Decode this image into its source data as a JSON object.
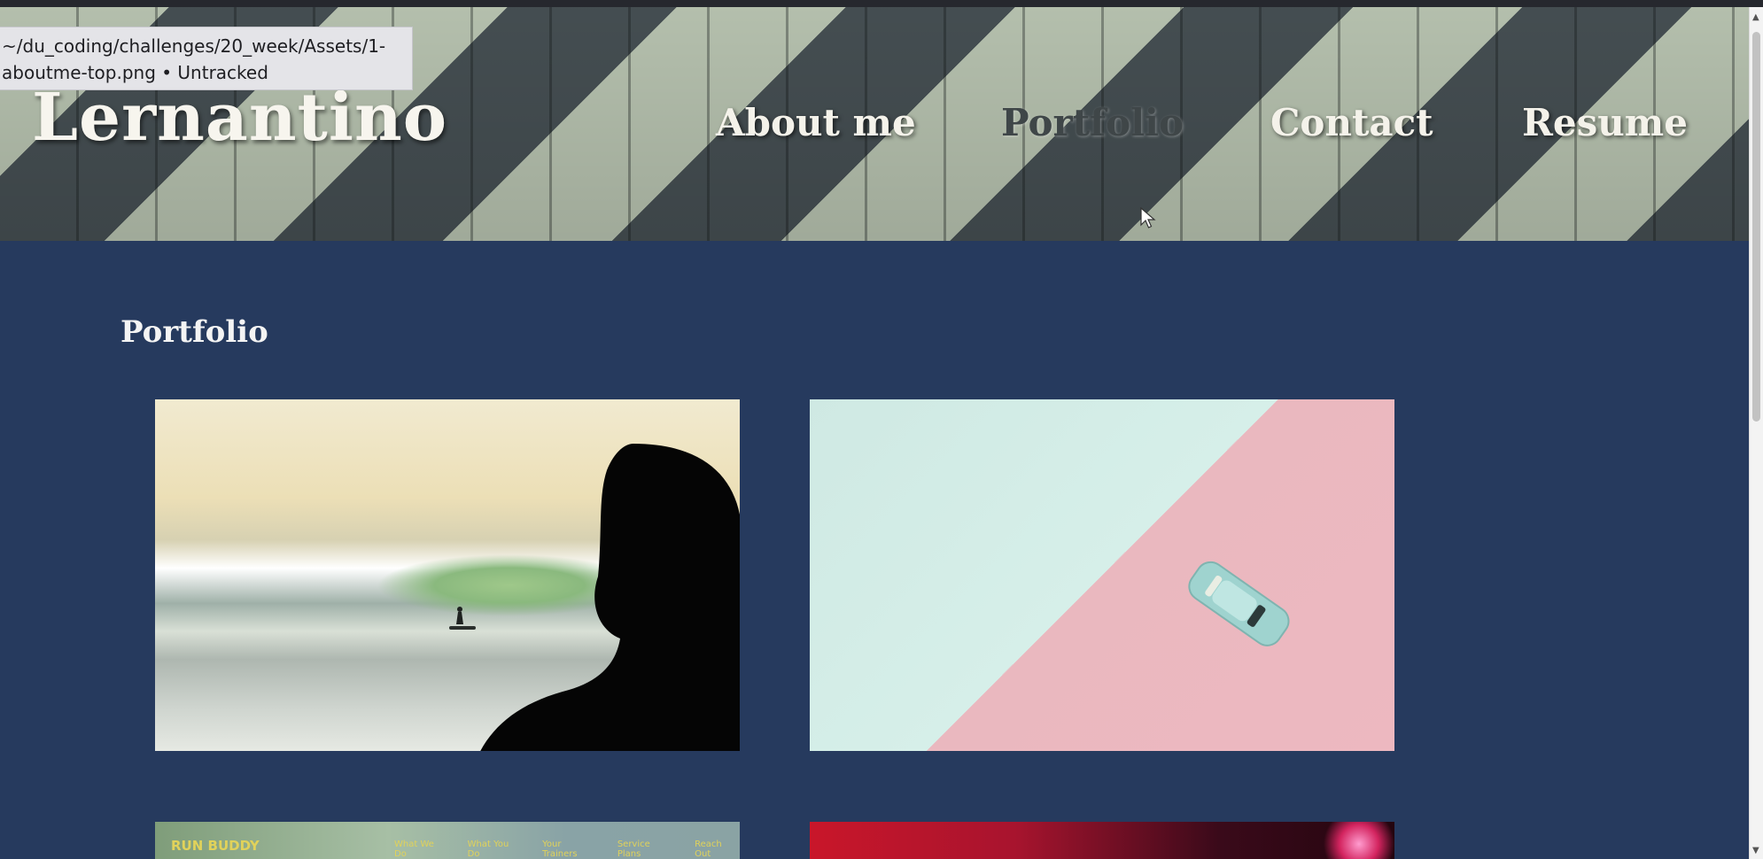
{
  "tooltip": {
    "line1": "~/du_coding/challenges/20_week/Assets/1-",
    "line2": "aboutme-top.png • Untracked"
  },
  "header": {
    "logo": "Lernantino",
    "nav": [
      {
        "label": "About me",
        "active": false
      },
      {
        "label": "Portfolio",
        "active": true
      },
      {
        "label": "Contact",
        "active": false
      },
      {
        "label": "Resume",
        "active": false
      }
    ]
  },
  "portfolio": {
    "title": "Portfolio",
    "cards": [
      {
        "image": "surfer-silhouette-photo"
      },
      {
        "image": "toy-car-photo"
      },
      {
        "image": "run-buddy-screenshot",
        "brand": "RUN BUDDY",
        "nav": [
          "What We Do",
          "What You Do",
          "Your Trainers",
          "Service Plans",
          "Reach Out"
        ]
      },
      {
        "image": "red-lights-photo"
      }
    ]
  },
  "colors": {
    "page_bg": "#263a5e",
    "header_light": "#c3cfbb",
    "header_dark": "#4a5458",
    "text_light": "#f4f2ea"
  },
  "icons": {
    "cursor": "mouse-pointer-icon"
  }
}
